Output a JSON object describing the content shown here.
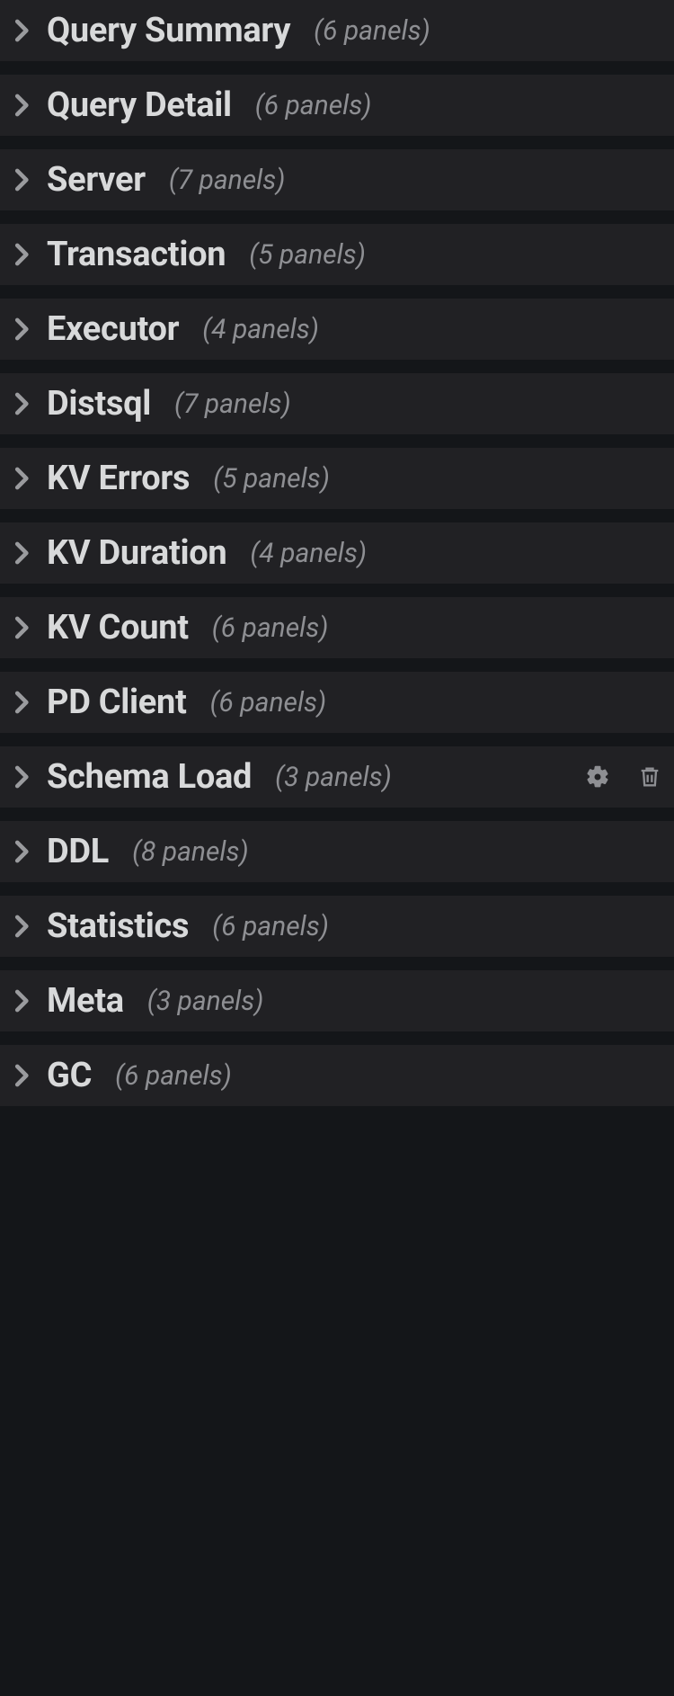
{
  "rows": [
    {
      "title": "Query Summary",
      "countText": "(6 panels)",
      "active": false
    },
    {
      "title": "Query Detail",
      "countText": "(6 panels)",
      "active": false
    },
    {
      "title": "Server",
      "countText": "(7 panels)",
      "active": false
    },
    {
      "title": "Transaction",
      "countText": "(5 panels)",
      "active": false
    },
    {
      "title": "Executor",
      "countText": "(4 panels)",
      "active": false
    },
    {
      "title": "Distsql",
      "countText": "(7 panels)",
      "active": false
    },
    {
      "title": "KV Errors",
      "countText": "(5 panels)",
      "active": false
    },
    {
      "title": "KV Duration",
      "countText": "(4 panels)",
      "active": false
    },
    {
      "title": "KV Count",
      "countText": "(6 panels)",
      "active": false
    },
    {
      "title": "PD Client",
      "countText": "(6 panels)",
      "active": false
    },
    {
      "title": "Schema Load",
      "countText": "(3 panels)",
      "active": true
    },
    {
      "title": "DDL",
      "countText": "(8 panels)",
      "active": false
    },
    {
      "title": "Statistics",
      "countText": "(6 panels)",
      "active": false
    },
    {
      "title": "Meta",
      "countText": "(3 panels)",
      "active": false
    },
    {
      "title": "GC",
      "countText": "(6 panels)",
      "active": false
    }
  ]
}
